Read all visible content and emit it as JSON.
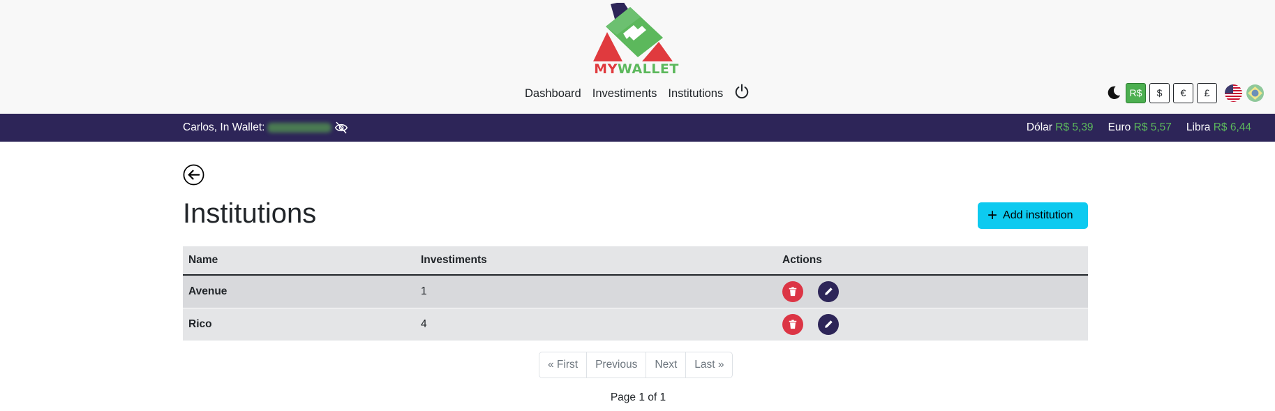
{
  "brand": {
    "my": "MY",
    "wallet": "WALLET"
  },
  "nav": {
    "dashboard": "Dashboard",
    "investments": "Investiments",
    "institutions": "Institutions"
  },
  "currency_buttons": [
    "R$",
    "$",
    "€",
    "£"
  ],
  "active_currency": "R$",
  "user_bar": {
    "greeting": "Carlos, In Wallet:"
  },
  "rates": [
    {
      "label": "Dólar",
      "value": "R$ 5,39"
    },
    {
      "label": "Euro",
      "value": "R$ 5,57"
    },
    {
      "label": "Libra",
      "value": "R$ 6,44"
    }
  ],
  "page": {
    "title": "Institutions",
    "add_button": "Add institution"
  },
  "table": {
    "headers": [
      "Name",
      "Investiments",
      "Actions"
    ],
    "rows": [
      {
        "name": "Avenue",
        "investments": "1"
      },
      {
        "name": "Rico",
        "investments": "4"
      }
    ]
  },
  "pagination": {
    "first": "« First",
    "previous": "Previous",
    "next": "Next",
    "last": "Last »",
    "info": "Page 1 of 1"
  },
  "colors": {
    "brand_purple": "#2d2558",
    "accent_green": "#5cb85c",
    "danger": "#dc3545",
    "info": "#0dcaf0"
  }
}
